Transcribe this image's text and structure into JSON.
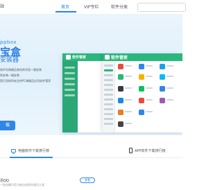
{
  "nav": {
    "logo_fragment": "站",
    "items": [
      {
        "label": "首页",
        "active": true
      },
      {
        "label": "VIP专栏",
        "active": false
      },
      {
        "label": "软件分类",
        "active": false
      }
    ],
    "search_placeholder": ""
  },
  "banner": {
    "subtitle": "ppbox",
    "title": "宝盒",
    "title2": "安装器",
    "lines": [
      "软件包和精品装机库实现一键安装",
      "免安装一键安装",
      "是打造纯净安全的PC端精品应用软件管家"
    ],
    "button_label": "载",
    "app_window": {
      "back_name": "软件管家",
      "front_name": "软件管家",
      "accent_color": "#2bb67d"
    }
  },
  "rank_tabs": [
    {
      "label": "电脑软件下载排行榜",
      "icon": "monitor-icon",
      "active": true
    },
    {
      "label": "APP软件下载排行榜",
      "icon": "phone-icon",
      "active": false
    }
  ],
  "card": {
    "title": "讯QQ",
    "description": "一款由腾讯官方推出的即时通讯工具",
    "button_label": "查看"
  },
  "colors": {
    "accent": "#1a88e8",
    "app_green": "#2bb67d",
    "banner_bg": "#e4f2fc"
  }
}
